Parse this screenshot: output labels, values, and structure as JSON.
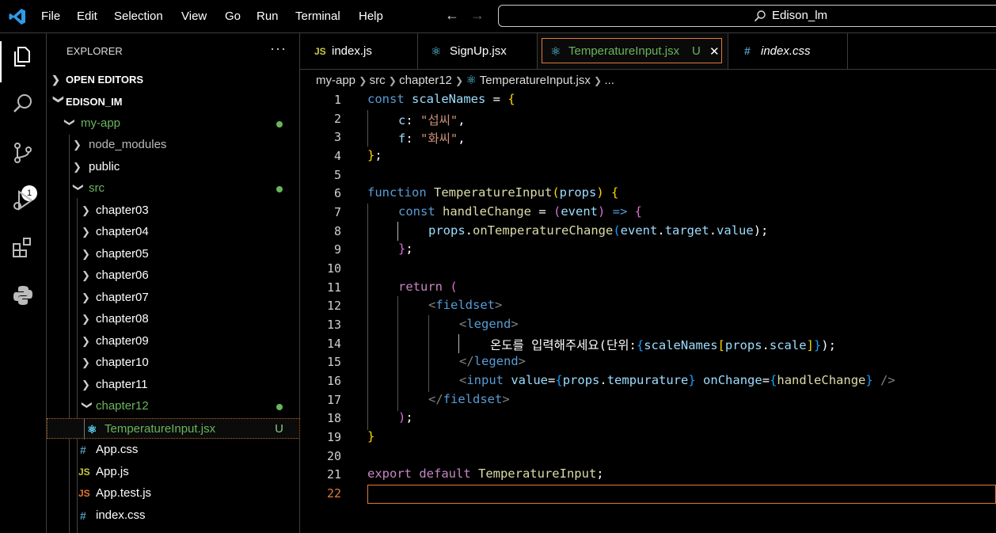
{
  "menu": [
    "File",
    "Edit",
    "Selection",
    "View",
    "Go",
    "Run",
    "Terminal",
    "Help"
  ],
  "command_center": "Edison_lm",
  "activity": {
    "scm_badge": "1"
  },
  "sidebar": {
    "title": "EXPLORER",
    "more": "···",
    "open_editors": "OPEN EDITORS",
    "root": "EDISON_IM",
    "tree": [
      {
        "label": "my-app",
        "color": "#6ab55c"
      },
      {
        "label": "node_modules",
        "color": "#bbbbbb"
      },
      {
        "label": "public",
        "color": "#ffffff"
      },
      {
        "label": "src",
        "color": "#6ab55c"
      },
      {
        "label": "chapter03"
      },
      {
        "label": "chapter04"
      },
      {
        "label": "chapter05"
      },
      {
        "label": "chapter06"
      },
      {
        "label": "chapter07"
      },
      {
        "label": "chapter08"
      },
      {
        "label": "chapter09"
      },
      {
        "label": "chapter10"
      },
      {
        "label": "chapter11"
      },
      {
        "label": "chapter12",
        "color": "#6ab55c"
      },
      {
        "label": "TemperatureInput.jsx",
        "status": "U",
        "color": "#6ab55c"
      },
      {
        "label": "App.css",
        "icon": "#"
      },
      {
        "label": "App.js",
        "icon": "JS"
      },
      {
        "label": "App.test.js",
        "icon": "JS"
      },
      {
        "label": "index.css",
        "icon": "#"
      }
    ]
  },
  "tabs": [
    {
      "label": "index.js",
      "icon": "JS"
    },
    {
      "label": "SignUp.jsx",
      "icon": "react"
    },
    {
      "label": "TemperatureInput.jsx",
      "icon": "react",
      "status": "U",
      "close": "✕"
    },
    {
      "label": "index.css",
      "icon": "#"
    }
  ],
  "breadcrumb": [
    "my-app",
    "src",
    "chapter12",
    "TemperatureInput.jsx",
    "..."
  ],
  "editor": {
    "line_numbers": [
      "1",
      "2",
      "3",
      "4",
      "5",
      "6",
      "7",
      "8",
      "9",
      "10",
      "11",
      "12",
      "13",
      "14",
      "15",
      "16",
      "17",
      "18",
      "19",
      "20",
      "21",
      "22"
    ],
    "code": {
      "l1": [
        "const ",
        "scaleNames",
        " = ",
        "{"
      ],
      "l2": [
        "c",
        ": ",
        "\"섭씨\"",
        ","
      ],
      "l3": [
        "f",
        ": ",
        "\"화씨\"",
        ","
      ],
      "l4": [
        "}",
        ";"
      ],
      "l6": [
        "function ",
        "TemperatureInput",
        "(",
        "props",
        ") ",
        "{"
      ],
      "l7": [
        "const ",
        "handleChange",
        " = ",
        "(",
        "event",
        ") ",
        "=> ",
        "{"
      ],
      "l8": [
        "props",
        ".",
        "onTemperatureChange",
        "(",
        "event",
        ".",
        "target",
        ".",
        "value",
        ");"
      ],
      "l9": [
        "}",
        ";"
      ],
      "l11": [
        "return ",
        "("
      ],
      "l12": [
        "<",
        "fieldset",
        ">"
      ],
      "l13": [
        "<",
        "legend",
        ">"
      ],
      "l14": [
        "온도를 입력해주세요(단위:",
        "{",
        "scaleNames",
        "[",
        "props",
        ".",
        "scale",
        "]",
        "}",
        ");"
      ],
      "l15": [
        "</",
        "legend",
        ">"
      ],
      "l16": [
        "<",
        "input ",
        "value",
        "=",
        "{",
        "props",
        ".",
        "tempurature",
        "} ",
        "onChange",
        "=",
        "{",
        "handleChange",
        "} ",
        "/>"
      ],
      "l17": [
        "</",
        "fieldset",
        ">"
      ],
      "l18": [
        ")",
        ";"
      ],
      "l19": [
        "}"
      ],
      "l21": [
        "export ",
        "default ",
        "TemperatureInput",
        ";"
      ]
    }
  }
}
